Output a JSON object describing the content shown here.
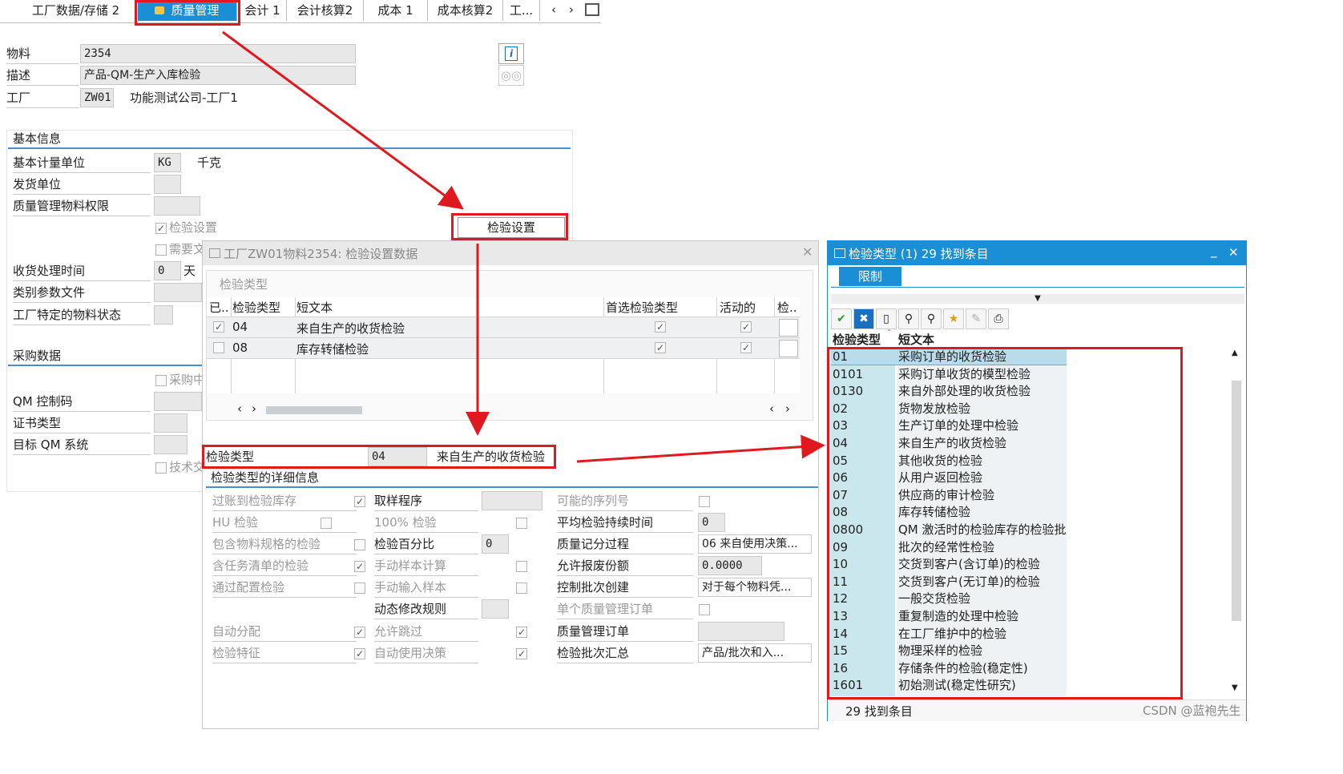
{
  "tabs": [
    "工厂数据/存储 2",
    "质量管理",
    "会计 1",
    "会计核算2",
    "成本 1",
    "成本核算2",
    "工..."
  ],
  "header": {
    "material_label": "物料",
    "material_value": "2354",
    "desc_label": "描述",
    "desc_value": "产品-QM-生产入库检验",
    "plant_label": "工厂",
    "plant_value": "ZW01",
    "plant_name": "功能测试公司-工厂1"
  },
  "basic": {
    "title": "基本信息",
    "uom_label": "基本计量单位",
    "uom_value": "KG",
    "uom_text": "千克",
    "issue_unit_label": "发货单位",
    "qm_auth_label": "质量管理物料权限",
    "insp_setup_chk": "检验设置",
    "needs_chk": "需要文",
    "insp_setup_btn": "检验设置",
    "gr_time_label": "收货处理时间",
    "gr_time_value": "0",
    "gr_time_unit": "天",
    "class_label": "类别参数文件",
    "plant_status_label": "工厂特定的物料状态"
  },
  "purchasing": {
    "title": "采购数据",
    "chk1": "采购中",
    "qm_control_label": "QM 控制码",
    "cert_label": "证书类型",
    "target_qm_label": "目标 QM 系统",
    "chk2": "技术交"
  },
  "dialog1": {
    "title": "工厂ZW01物料2354: 检验设置数据",
    "group_label": "检验类型",
    "columns": [
      "已..",
      "检验类型",
      "短文本",
      "首选检验类型",
      "活动的",
      "检.."
    ],
    "rows": [
      {
        "type": "04",
        "text": "来自生产的收货检验"
      },
      {
        "type": "08",
        "text": "库存转储检验"
      }
    ],
    "detail_type_label": "检验类型",
    "detail_type_value": "04",
    "detail_type_text": "来自生产的收货检验",
    "detail_title": "检验类型的详细信息",
    "col1": [
      "过账到检验库存",
      "HU 检验",
      "包含物料规格的检验",
      "含任务清单的检验",
      "通过配置检验",
      "",
      "自动分配",
      "检验特征"
    ],
    "col2": [
      "取样程序",
      "100% 检验",
      "检验百分比",
      "手动样本计算",
      "手动输入样本",
      "动态修改规则",
      "允许跳过",
      "自动使用决策"
    ],
    "pct_value": "0",
    "col3": [
      "可能的序列号",
      "平均检验持续时间",
      "质量记分过程",
      "允许报废份额",
      "控制批次创建",
      "单个质量管理订单",
      "质量管理订单",
      "检验批次汇总"
    ],
    "avg_dur_value": "0",
    "score_value": "06 来自使用决策...",
    "scrap_value": "0.0000",
    "lot_create_value": "对于每个物料凭...",
    "lot_summary_value": "产品/批次和入..."
  },
  "dialog2": {
    "title": "检验类型 (1)   29 找到条目",
    "tab": "限制",
    "col_type": "检验类型",
    "col_text": "短文本",
    "rows": [
      [
        "01",
        "采购订单的收货检验"
      ],
      [
        "0101",
        "采购订单收货的模型检验"
      ],
      [
        "0130",
        "来自外部处理的收货检验"
      ],
      [
        "02",
        "货物发放检验"
      ],
      [
        "03",
        "生产订单的处理中检验"
      ],
      [
        "04",
        "来自生产的收货检验"
      ],
      [
        "05",
        "其他收货的检验"
      ],
      [
        "06",
        "从用户返回检验"
      ],
      [
        "07",
        "供应商的审计检验"
      ],
      [
        "08",
        "库存转储检验"
      ],
      [
        "0800",
        "QM 激活时的检验库存的检验批"
      ],
      [
        "09",
        "批次的经常性检验"
      ],
      [
        "10",
        "交货到客户(含订单)的检验"
      ],
      [
        "11",
        "交货到客户(无订单)的检验"
      ],
      [
        "12",
        "一般交货检验"
      ],
      [
        "13",
        "重复制造的处理中检验"
      ],
      [
        "14",
        "在工厂维护中的检验"
      ],
      [
        "15",
        "物理采样的检验"
      ],
      [
        "16",
        "存储条件的检验(稳定性)"
      ],
      [
        "1601",
        "初始测试(稳定性研究)"
      ]
    ],
    "status": "29 找到条目"
  },
  "watermark": "CSDN @蓝袍先生",
  "colors": {
    "accent": "#1a8fd6",
    "annotation": "#e0191f"
  }
}
